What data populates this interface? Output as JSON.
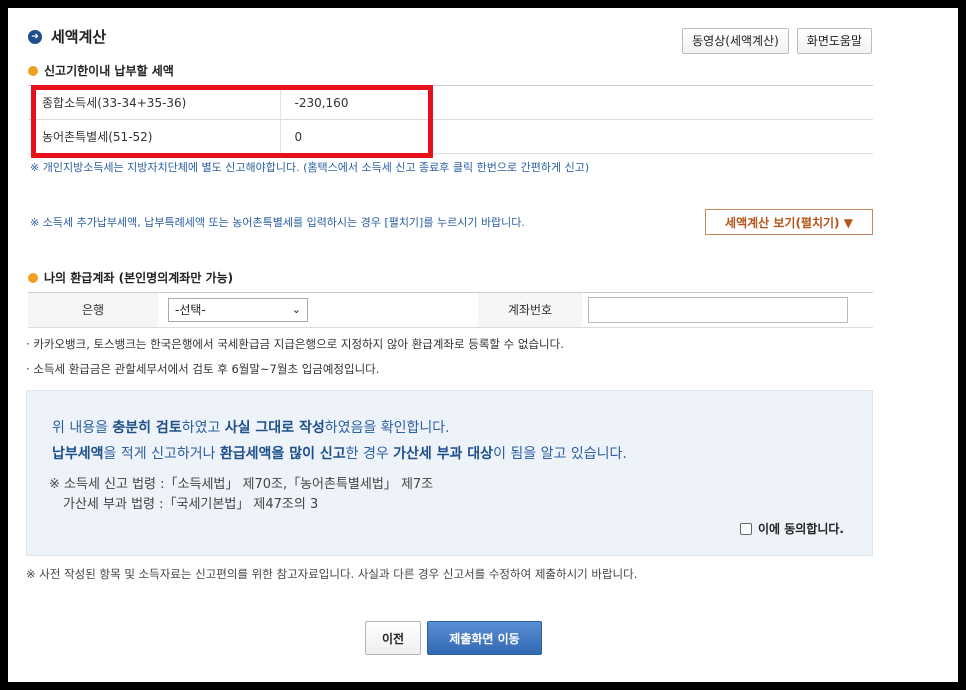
{
  "header": {
    "title": "세액계산",
    "video_button": "동영상(세액계산)",
    "help_button": "화면도움말"
  },
  "tax_section": {
    "title": "신고기한이내 납부할 세액",
    "rows": [
      {
        "label": "종합소득세(33-34+35-36)",
        "value": "-230,160"
      },
      {
        "label": "농어촌특별세(51-52)",
        "value": "0"
      }
    ],
    "note_local_tax": "※ 개인지방소득세는 지방자치단체에 별도 신고해야합니다. (홈택스에서 소득세 신고 종료후 클릭 한번으로 간편하게 신고)",
    "note_spread": "※ 소득세 추가납부세액, 납부특례세액 또는 농어촌특별세를 입력하시는 경우 [펼치기]를 누르시기 바랍니다.",
    "spread_button": "세액계산 보기(펼치기) ▼"
  },
  "refund_section": {
    "title": "나의 환급계좌 (본인명의계좌만 가능)",
    "bank_label": "은행",
    "bank_selected": "-선택-",
    "account_label": "계좌번호",
    "account_value": "",
    "notes": [
      "카카오뱅크, 토스뱅크는 한국은행에서 국세환급금 지급은행으로 지정하지 않아 환급계좌로 등록할 수 없습니다.",
      "소득세 환급금은 관할세무서에서 검토 후 6월말~7월초 입금예정입니다."
    ]
  },
  "confirm": {
    "line1_a": "위 내용을 ",
    "line1_b": "충분히 검토",
    "line1_c": "하였고 ",
    "line1_d": "사실 그대로 작성",
    "line1_e": "하였음을 확인합니다.",
    "line2_a": "납부세액",
    "line2_b": "을 적게 신고하거나 ",
    "line2_c": "환급세액",
    "line2_d": "을 많이 신고",
    "line2_e": "한 경우 ",
    "line2_f": "가산세 부과 대상",
    "line2_g": "이 됨을 알고 있습니다.",
    "law1": "※ 소득세 신고 법령 :「소득세법」 제70조,「농어촌특별세법」 제7조",
    "law2": "가산세 부과 법령 :「국세기본법」 제47조의 3",
    "agree_label": "이에 동의합니다."
  },
  "footer_note": "※ 사전 작성된 항목 및 소득자료는 신고편의를 위한 참고자료입니다. 사실과 다른 경우 신고서를 수정하여 제출하시기 바랍니다.",
  "buttons": {
    "prev": "이전",
    "next": "제출화면 이동"
  }
}
